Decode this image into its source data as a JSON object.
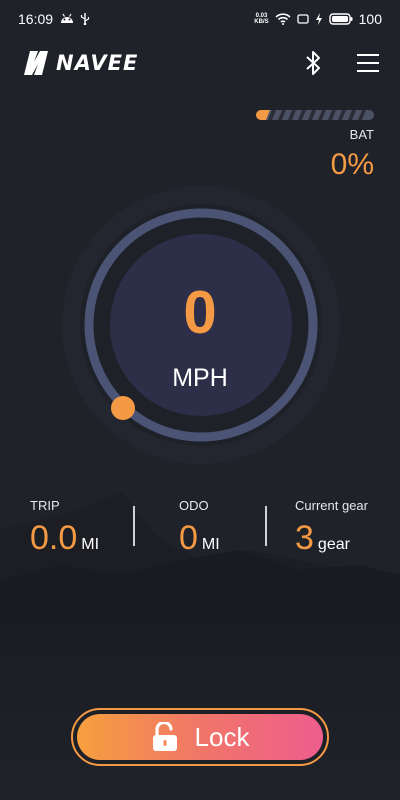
{
  "status_bar": {
    "time": "16:09",
    "net_speed_value": "0.03",
    "net_speed_unit": "KB/S",
    "battery_level": "100"
  },
  "header": {
    "brand": "NAVEE"
  },
  "battery": {
    "label": "BAT",
    "value": "0%",
    "fill_fraction": 0.0
  },
  "speedometer": {
    "speed": "0",
    "unit": "MPH"
  },
  "stats": {
    "trip": {
      "label": "TRIP",
      "value": "0.0",
      "unit": "MI"
    },
    "odo": {
      "label": "ODO",
      "value": "0",
      "unit": "MI"
    },
    "gear": {
      "label": "Current gear",
      "value": "3",
      "unit": "gear"
    }
  },
  "lock_button": {
    "label": "Lock"
  },
  "colors": {
    "background": "#1f2229",
    "accent": "#f59a44",
    "gauge_ring": "#4c5475",
    "gauge_face": "#2d2e48"
  },
  "icons": [
    "android-icon",
    "usb-icon",
    "wifi-icon",
    "screen-icon",
    "charging-icon",
    "battery-icon",
    "bluetooth-icon",
    "menu-icon",
    "lock-open-icon"
  ]
}
